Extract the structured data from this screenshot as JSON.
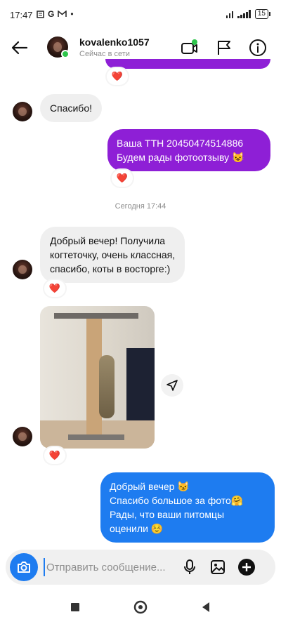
{
  "status_bar": {
    "time": "17:47",
    "left_icons": "G",
    "battery": "15"
  },
  "header": {
    "username": "kovalenko1057",
    "status": "Сейчас в сети"
  },
  "messages": {
    "m1": {
      "text": "Спасибо!"
    },
    "m2": {
      "lines": [
        "Ваша ТТН 20450474514886",
        "Будем рады фотоотзыву 😺"
      ]
    },
    "timestamp": "Сегодня 17:44",
    "m3": {
      "lines": [
        "Добрый вечер! Получила",
        "когтеточку, очень классная,",
        "спасибо, коты в восторге:)"
      ]
    },
    "m5": {
      "lines": [
        "Добрый вечер 😼",
        "Спасибо большое за фото🤗",
        "Рады, что ваши питомцы",
        "оценили ☺️"
      ]
    },
    "reaction": "❤️"
  },
  "composer": {
    "placeholder": "Отправить сообщение..."
  },
  "icons": {
    "back": "arrow-left-icon",
    "video": "video-camera-icon",
    "flag": "flag-icon",
    "info": "info-icon",
    "camera": "camera-icon",
    "mic": "microphone-icon",
    "gallery": "image-icon",
    "plus": "plus-circle-icon",
    "share": "send-icon"
  },
  "colors": {
    "outgoing_purple": "#8e1fd6",
    "outgoing_blue": "#1e7cf0",
    "incoming": "#efefef",
    "online": "#2ec54b"
  }
}
